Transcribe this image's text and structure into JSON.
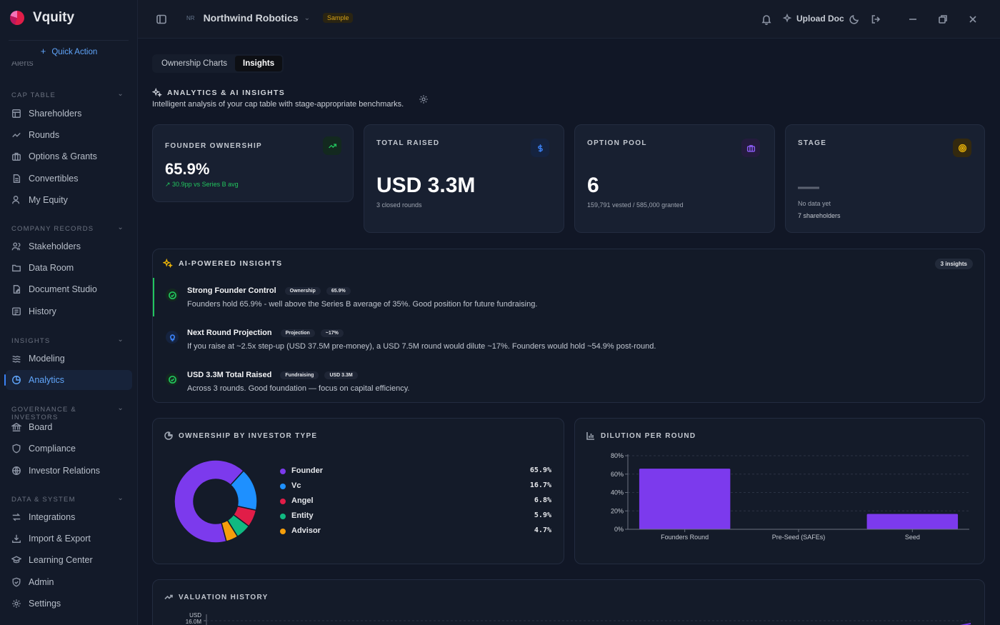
{
  "app": {
    "name": "Vquity"
  },
  "sidebar": {
    "quick_action": "Quick Action",
    "partial_item": "Alerts",
    "sections": [
      {
        "label": "CAP TABLE",
        "items": [
          "Shareholders",
          "Rounds",
          "Options & Grants",
          "Convertibles",
          "My Equity"
        ]
      },
      {
        "label": "COMPANY RECORDS",
        "items": [
          "Stakeholders",
          "Data Room",
          "Document Studio",
          "History"
        ]
      },
      {
        "label": "INSIGHTS",
        "items": [
          "Modeling",
          "Analytics"
        ]
      },
      {
        "label": "GOVERNANCE & INVESTORS",
        "items": [
          "Board",
          "Compliance",
          "Investor Relations"
        ]
      },
      {
        "label": "DATA & SYSTEM",
        "items": [
          "Integrations",
          "Import & Export",
          "Learning Center",
          "Admin",
          "Settings"
        ]
      }
    ],
    "active_item": "Analytics"
  },
  "topbar": {
    "company_initials": "NR",
    "company_name": "Northwind Robotics",
    "badge": "Sample",
    "upload_label": "Upload Doc"
  },
  "tabs": [
    {
      "label": "Ownership Charts",
      "active": false
    },
    {
      "label": "Insights",
      "active": true
    }
  ],
  "header": {
    "title": "ANALYTICS & AI INSIGHTS",
    "subtitle": "Intelligent analysis of your cap table with stage-appropriate benchmarks."
  },
  "kpis": [
    {
      "label": "FOUNDER OWNERSHIP",
      "value": "65.9%",
      "sub": "30.9pp vs Series B avg",
      "accent": "#22c55e",
      "icon": "trending-up-icon"
    },
    {
      "label": "TOTAL RAISED",
      "value": "USD 3.3M",
      "sub": "3 closed rounds",
      "accent": "#3b82f6",
      "icon": "dollar-icon"
    },
    {
      "label": "OPTION POOL",
      "value": "6",
      "sub": "159,791 vested / 585,000 granted",
      "accent": "#8b5cf6",
      "icon": "briefcase-icon"
    },
    {
      "label": "STAGE",
      "value": "—",
      "sub": "No data yet",
      "sub2": "7 shareholders",
      "accent": "#eab308",
      "icon": "target-icon"
    }
  ],
  "insights": {
    "title": "AI-POWERED INSIGHTS",
    "count": "3 insights",
    "items": [
      {
        "title": "Strong Founder Control",
        "tags": [
          "Ownership",
          "65.9%"
        ],
        "desc": "Founders hold 65.9% - well above the Series B average of 35%. Good position for future fundraising.",
        "icon": "check-circle-icon",
        "color": "#22c55e"
      },
      {
        "title": "Next Round Projection",
        "tags": [
          "Projection",
          "~17%"
        ],
        "desc": "If you raise at ~2.5x step-up (USD 37.5M pre-money), a USD 7.5M round would dilute ~17%. Founders would hold ~54.9% post-round.",
        "icon": "lightbulb-icon",
        "color": "#3b82f6"
      },
      {
        "title": "USD 3.3M Total Raised",
        "tags": [
          "Fundraising",
          "USD 3.3M"
        ],
        "desc": "Across 3 rounds. Good foundation — focus on capital efficiency.",
        "icon": "check-circle-icon",
        "color": "#22c55e"
      }
    ]
  },
  "ownership": {
    "title": "OWNERSHIP BY INVESTOR TYPE",
    "items": [
      {
        "name": "Founder",
        "value": 65.9,
        "label": "65.9%",
        "color": "#7c3aed"
      },
      {
        "name": "Vc",
        "value": 16.7,
        "label": "16.7%",
        "color": "#1e90ff"
      },
      {
        "name": "Angel",
        "value": 6.8,
        "label": "6.8%",
        "color": "#e11d48"
      },
      {
        "name": "Entity",
        "value": 5.9,
        "label": "5.9%",
        "color": "#10b981"
      },
      {
        "name": "Advisor",
        "value": 4.7,
        "label": "4.7%",
        "color": "#f59e0b"
      }
    ]
  },
  "dilution": {
    "title": "DILUTION PER ROUND",
    "chart_data": {
      "type": "bar",
      "categories": [
        "Founders Round",
        "Pre-Seed (SAFEs)",
        "Seed"
      ],
      "values": [
        65.9,
        0,
        16.7
      ],
      "yticks": [
        "0%",
        "20%",
        "40%",
        "60%",
        "80%"
      ],
      "ylim": [
        0,
        80
      ],
      "color": "#7c3aed",
      "grid": true
    }
  },
  "valuation": {
    "title": "VALUATION HISTORY",
    "ytick_top_1": "USD",
    "ytick_top_2": "16.0M"
  }
}
